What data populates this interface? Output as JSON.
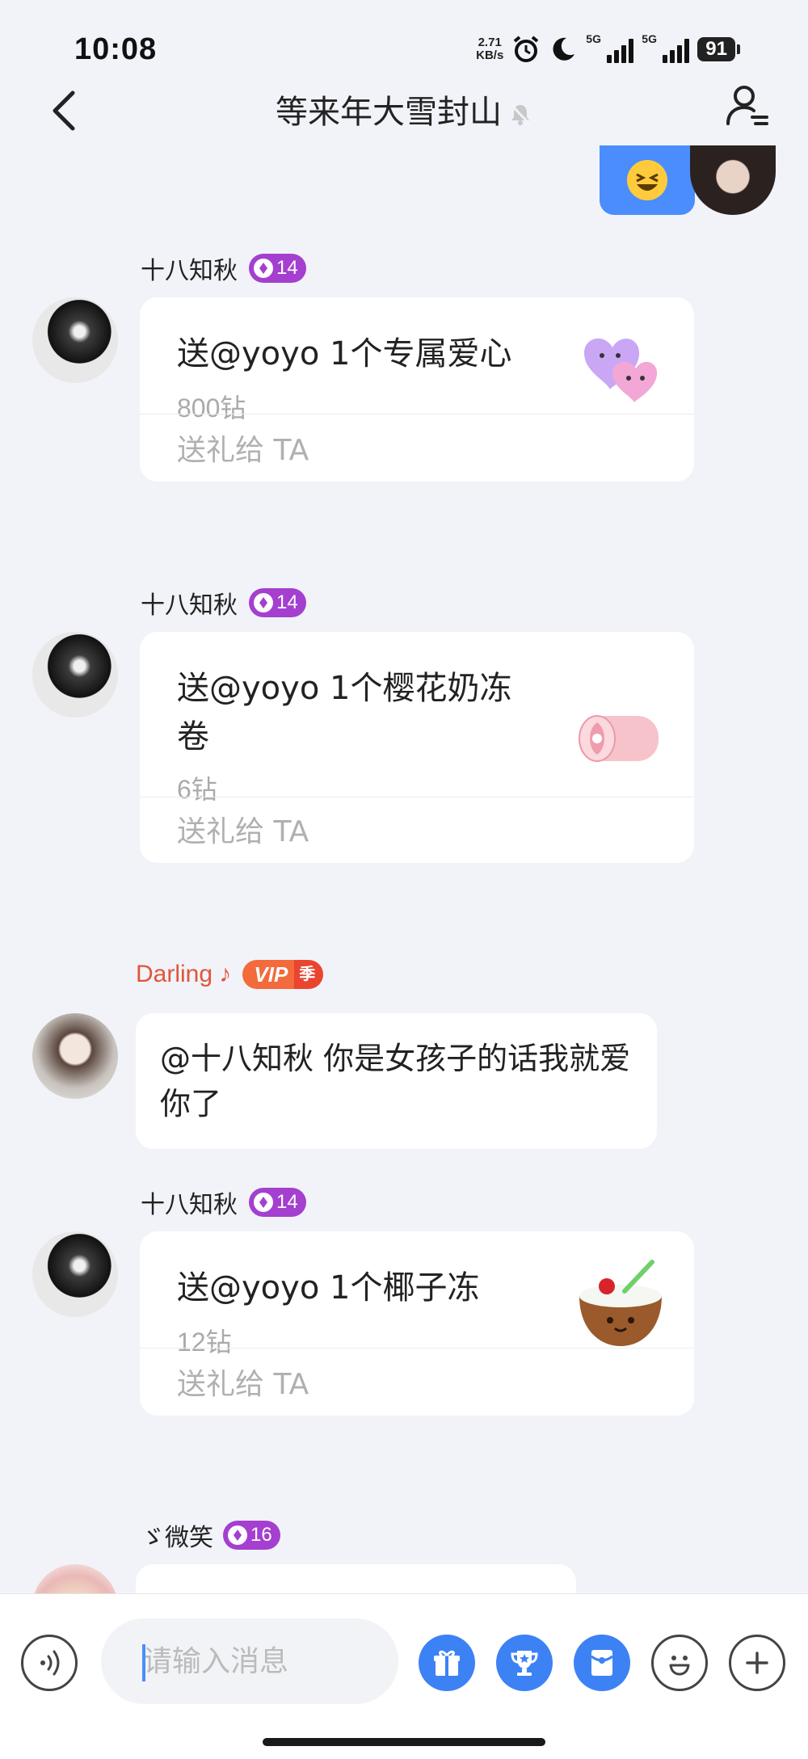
{
  "status_bar": {
    "time": "10:08",
    "net_speed_value": "2.71",
    "net_speed_unit": "KB/s",
    "signal1_label": "5G",
    "signal2_label": "5G",
    "battery": "91"
  },
  "header": {
    "title": "等来年大雪封山"
  },
  "messages": {
    "gift1": {
      "sender": "十八知秋",
      "level": "14",
      "title": "送@yoyo 1个专属爱心",
      "price": "800钻",
      "action": "送礼给 TA"
    },
    "gift2": {
      "sender": "十八知秋",
      "level": "14",
      "title": "送@yoyo 1个樱花奶冻卷",
      "price": "6钻",
      "action": "送礼给 TA"
    },
    "text1": {
      "sender": "Darling ♪",
      "vip_label": "VIP",
      "vip_tier": "季",
      "text": "@十八知秋 你是女孩子的话我就爱你了"
    },
    "gift3": {
      "sender": "十八知秋",
      "level": "14",
      "title": "送@yoyo 1个椰子冻",
      "price": "12钻",
      "action": "送礼给 TA"
    },
    "partial": {
      "sender": "ゞ微笑",
      "level": "16"
    }
  },
  "input_bar": {
    "placeholder": "请输入消息"
  },
  "colors": {
    "accent_blue": "#3d82f5",
    "own_bubble": "#4b8dfc",
    "level_badge": "#a43fd0",
    "vip_orange": "#f36a3c",
    "sender_red": "#e0553b"
  },
  "icons": {
    "back": "chevron-left-icon",
    "bell": "muted-bell-icon",
    "profile": "user-settings-icon",
    "voice": "voice-icon",
    "gift": "gift-icon",
    "trophy": "trophy-icon",
    "redpacket": "red-packet-icon",
    "emoji": "smiley-icon",
    "plus": "plus-icon"
  }
}
